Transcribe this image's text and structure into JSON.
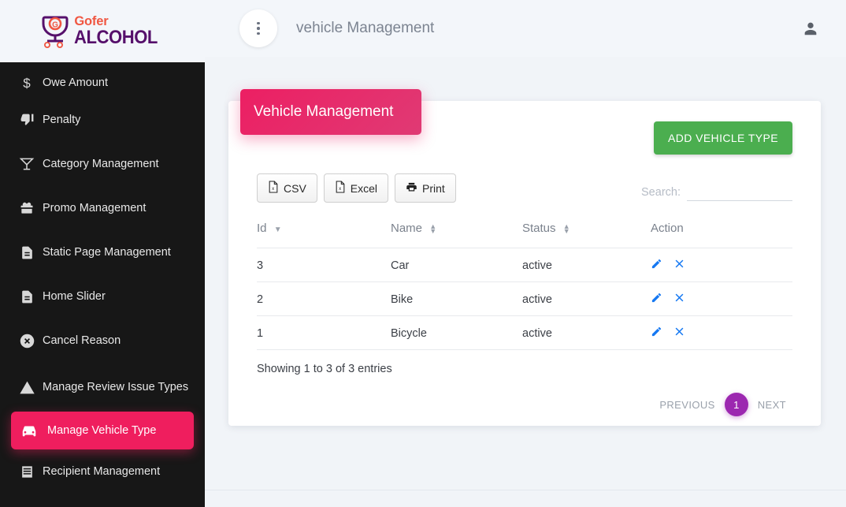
{
  "brand": {
    "name_top": "Gofer",
    "name_bottom": "ALCOHOL",
    "glass_letter": "G",
    "color_top": "#f05742",
    "color_bottom": "#56106b"
  },
  "sidebar": {
    "items": [
      {
        "label": "Owe Amount",
        "icon": "dollar-icon",
        "active": false,
        "clipped": true
      },
      {
        "label": "Penalty",
        "icon": "thumbs-down-icon",
        "active": false
      },
      {
        "label": "Category Management",
        "icon": "cocktail-glass-icon",
        "active": false
      },
      {
        "label": "Promo Management",
        "icon": "gift-icon",
        "active": false
      },
      {
        "label": "Static Page Management",
        "icon": "document-icon",
        "active": false
      },
      {
        "label": "Home Slider",
        "icon": "document-icon",
        "active": false
      },
      {
        "label": "Cancel Reason",
        "icon": "circle-x-icon",
        "active": false
      },
      {
        "label": "Manage Review Issue Types",
        "icon": "warning-triangle-icon",
        "active": false
      },
      {
        "label": "Manage Vehicle Type",
        "icon": "car-icon",
        "active": true
      },
      {
        "label": "Recipient Management",
        "icon": "list-icon",
        "active": false
      }
    ],
    "active_color": "#ef1e5e",
    "background": "#171717"
  },
  "topbar": {
    "menu_icon": "kebab-menu-icon",
    "title": "vehicle Management",
    "user_icon": "user-account-icon"
  },
  "banner": {
    "title": "Vehicle Management",
    "color": "#ec1f63"
  },
  "actions": {
    "add_button": "ADD VEHICLE TYPE",
    "add_button_color": "#4bae4f"
  },
  "export": {
    "csv": "CSV",
    "excel": "Excel",
    "print": "Print"
  },
  "search": {
    "label": "Search:",
    "value": "",
    "placeholder": ""
  },
  "table": {
    "columns": [
      {
        "label": "Id",
        "sort": "desc"
      },
      {
        "label": "Name",
        "sort": "none"
      },
      {
        "label": "Status",
        "sort": "none"
      },
      {
        "label": "Action",
        "sort": null
      }
    ],
    "rows": [
      {
        "id": "3",
        "name": "Car",
        "status": "active",
        "edit_icon": "pencil-icon",
        "delete_icon": "close-x-icon"
      },
      {
        "id": "2",
        "name": "Bike",
        "status": "active",
        "edit_icon": "pencil-icon",
        "delete_icon": "close-x-icon"
      },
      {
        "id": "1",
        "name": "Bicycle",
        "status": "active",
        "edit_icon": "pencil-icon",
        "delete_icon": "close-x-icon"
      }
    ]
  },
  "footer": {
    "showing": "Showing 1 to 3 of 3 entries",
    "previous": "PREVIOUS",
    "page": "1",
    "next": "NEXT",
    "page_color": "#9c27b0"
  }
}
